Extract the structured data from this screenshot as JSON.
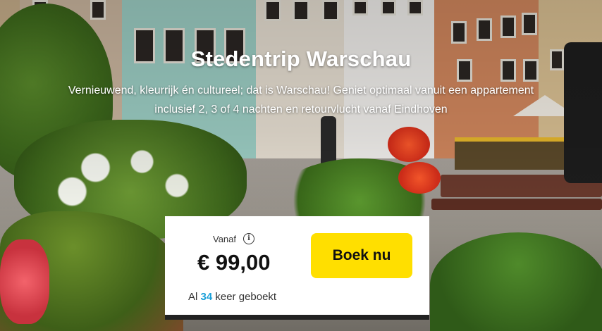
{
  "hero": {
    "title": "Stedentrip Warschau",
    "subtitle": "Vernieuwend, kleurrijk én cultureel; dat is Warschau! Geniet optimaal vanuit een appartement inclusief 2, 3 of 4 nachten en retourvlucht vanaf Eindhoven"
  },
  "card": {
    "from_label": "Vanaf",
    "info_icon": "i",
    "price": "€ 99,00",
    "booked_prefix": "Al",
    "booked_count": "34",
    "booked_suffix": "keer geboekt",
    "book_button": "Boek nu"
  },
  "colors": {
    "button": "#ffdf00",
    "count_accent": "#1a9fd8",
    "card_border": "#222222"
  }
}
